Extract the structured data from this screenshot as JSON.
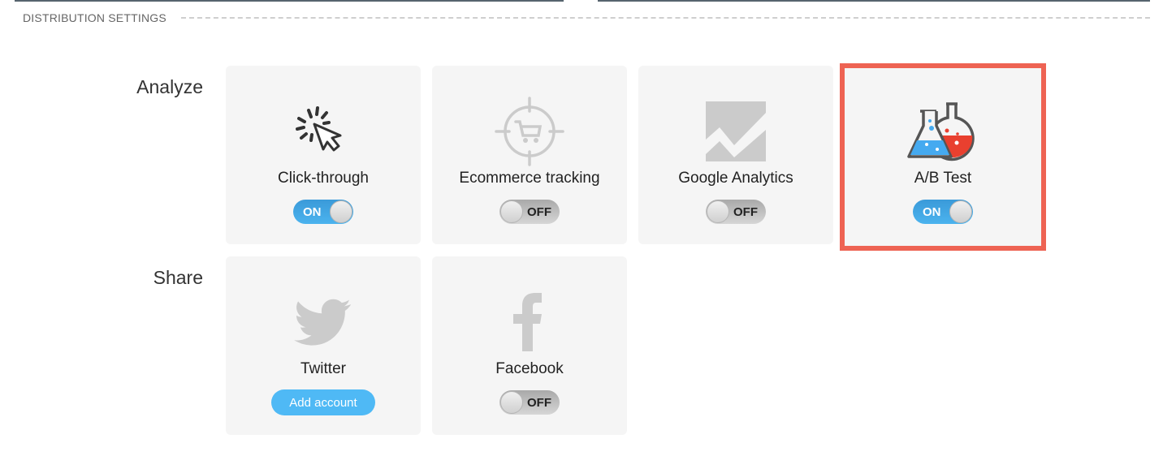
{
  "section": {
    "title": "DISTRIBUTION SETTINGS"
  },
  "groups": [
    {
      "label": "Analyze",
      "items": [
        {
          "name": "Click-through",
          "icon": "cursor-click-icon",
          "control": "toggle",
          "state": "ON"
        },
        {
          "name": "Ecommerce tracking",
          "icon": "cart-target-icon",
          "control": "toggle",
          "state": "OFF"
        },
        {
          "name": "Google Analytics",
          "icon": "analytics-chart-icon",
          "control": "toggle",
          "state": "OFF"
        },
        {
          "name": "A/B Test",
          "icon": "flasks-icon",
          "control": "toggle",
          "state": "ON",
          "highlighted": true
        }
      ]
    },
    {
      "label": "Share",
      "items": [
        {
          "name": "Twitter",
          "icon": "twitter-bird-icon",
          "control": "button",
          "button_label": "Add account"
        },
        {
          "name": "Facebook",
          "icon": "facebook-f-icon",
          "control": "toggle",
          "state": "OFF"
        }
      ]
    }
  ],
  "colors": {
    "toggle_on": "#3fa6e4",
    "toggle_off": "#bdbdbd",
    "add_button": "#4fb9f5",
    "highlight": "#ee6353",
    "card_bg": "#f5f5f5",
    "flask_blue": "#45aaf0",
    "flask_red": "#e9402f"
  }
}
